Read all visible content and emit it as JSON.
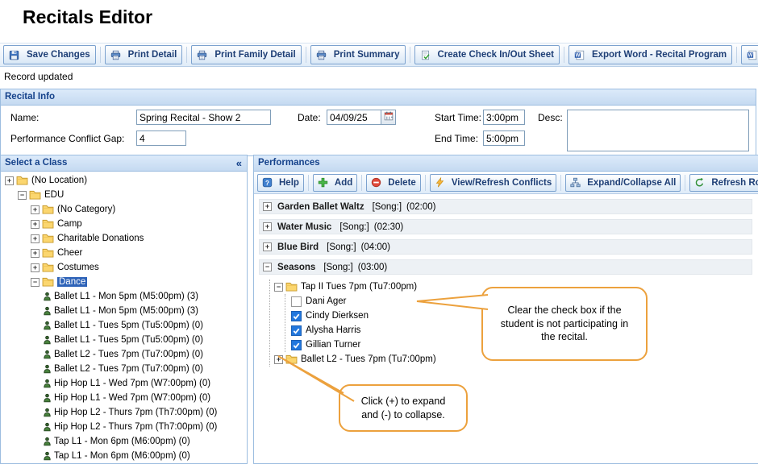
{
  "page_title": "Recitals Editor",
  "status_text": "Record updated",
  "toolbar": {
    "buttons": [
      {
        "label": "Save Changes",
        "icon": "save-icon",
        "name": "save-changes-button"
      },
      {
        "label": "Print Detail",
        "icon": "print-icon",
        "name": "print-detail-button"
      },
      {
        "label": "Print Family Detail",
        "icon": "print-icon",
        "name": "print-family-detail-button"
      },
      {
        "label": "Print Summary",
        "icon": "print-icon",
        "name": "print-summary-button"
      },
      {
        "label": "Create Check In/Out Sheet",
        "icon": "check-sheet-icon",
        "name": "create-check-in-out-sheet-button"
      },
      {
        "label": "Export Word - Recital Program",
        "icon": "word-icon",
        "name": "export-word-recital-program-button"
      },
      {
        "label": "",
        "icon": "word-icon",
        "name": "clipped-toolbar-button"
      }
    ]
  },
  "recital_info": {
    "header": "Recital Info",
    "name_label": "Name:",
    "name_value": "Spring Recital - Show 2",
    "gap_label": "Performance Conflict Gap:",
    "gap_value": "4",
    "date_label": "Date:",
    "date_value": "04/09/25",
    "start_label": "Start Time:",
    "start_value": "3:00pm",
    "end_label": "End Time:",
    "end_value": "5:00pm",
    "desc_label": "Desc:",
    "desc_value": ""
  },
  "class_panel": {
    "header": "Select a Class",
    "collapse_glyph": "«",
    "tree": [
      {
        "level": 0,
        "type": "folder",
        "expand": "+",
        "label": "(No Location)"
      },
      {
        "level": 1,
        "type": "folder",
        "expand": "-",
        "label": "EDU"
      },
      {
        "level": 2,
        "type": "folder",
        "expand": "+",
        "label": "(No Category)"
      },
      {
        "level": 2,
        "type": "folder",
        "expand": "+",
        "label": "Camp"
      },
      {
        "level": 2,
        "type": "folder",
        "expand": "+",
        "label": "Charitable Donations"
      },
      {
        "level": 2,
        "type": "folder",
        "expand": "+",
        "label": "Cheer"
      },
      {
        "level": 2,
        "type": "folder",
        "expand": "+",
        "label": "Costumes"
      },
      {
        "level": 2,
        "type": "folder",
        "expand": "-",
        "label": "Dance",
        "selected": true
      },
      {
        "level": 3,
        "type": "class",
        "label": "Ballet L1 - Mon 5pm (M5:00pm) (3)"
      },
      {
        "level": 3,
        "type": "class",
        "label": "Ballet L1 - Mon 5pm (M5:00pm) (3)"
      },
      {
        "level": 3,
        "type": "class",
        "label": "Ballet L1 - Tues 5pm (Tu5:00pm) (0)"
      },
      {
        "level": 3,
        "type": "class",
        "label": "Ballet L1 - Tues 5pm (Tu5:00pm) (0)"
      },
      {
        "level": 3,
        "type": "class",
        "label": "Ballet L2 - Tues 7pm (Tu7:00pm) (0)"
      },
      {
        "level": 3,
        "type": "class",
        "label": "Ballet L2 - Tues 7pm (Tu7:00pm) (0)"
      },
      {
        "level": 3,
        "type": "class",
        "label": "Hip Hop L1 - Wed 7pm (W7:00pm) (0)"
      },
      {
        "level": 3,
        "type": "class",
        "label": "Hip Hop L1 - Wed 7pm (W7:00pm) (0)"
      },
      {
        "level": 3,
        "type": "class",
        "label": "Hip Hop L2 - Thurs 7pm (Th7:00pm) (0)"
      },
      {
        "level": 3,
        "type": "class",
        "label": "Hip Hop L2 - Thurs 7pm (Th7:00pm) (0)"
      },
      {
        "level": 3,
        "type": "class",
        "label": "Tap L1 - Mon 6pm (M6:00pm) (0)"
      },
      {
        "level": 3,
        "type": "class",
        "label": "Tap L1 - Mon 6pm (M6:00pm) (0)"
      }
    ]
  },
  "performances_panel": {
    "header": "Performances",
    "toolbar": [
      {
        "label": "Help",
        "icon": "help-icon",
        "name": "help-button"
      },
      {
        "label": "Add",
        "icon": "add-icon",
        "name": "add-button"
      },
      {
        "label": "Delete",
        "icon": "delete-icon",
        "name": "delete-button"
      },
      {
        "label": "View/Refresh Conflicts",
        "icon": "conflicts-icon",
        "name": "view-refresh-conflicts-button"
      },
      {
        "label": "Expand/Collapse All",
        "icon": "expand-all-icon",
        "name": "expand-collapse-all-button"
      },
      {
        "label": "Refresh Rosters",
        "icon": "refresh-icon",
        "name": "refresh-rosters-button"
      }
    ],
    "rows": [
      {
        "expand": "+",
        "title": "Garden Ballet Waltz",
        "song": "[Song:]",
        "duration": "(02:00)"
      },
      {
        "expand": "+",
        "title": "Water Music",
        "song": "[Song:]",
        "duration": "(02:30)"
      },
      {
        "expand": "+",
        "title": "Blue Bird",
        "song": "[Song:]",
        "duration": "(04:00)"
      },
      {
        "expand": "-",
        "title": "Seasons",
        "song": "[Song:]",
        "duration": "(03:00)",
        "children": [
          {
            "expand": "-",
            "label": "Tap II Tues 7pm (Tu7:00pm)",
            "students": [
              {
                "name": "Dani Ager",
                "checked": false
              },
              {
                "name": "Cindy Dierksen",
                "checked": true
              },
              {
                "name": "Alysha Harris",
                "checked": true
              },
              {
                "name": "Gillian Turner",
                "checked": true
              }
            ]
          },
          {
            "expand": "+",
            "label": "Ballet L2 - Tues 7pm (Tu7:00pm)"
          }
        ]
      }
    ]
  },
  "callouts": [
    {
      "text": "Clear the check box if the student is not participating in the recital."
    },
    {
      "text": "Click (+) to expand and (-) to collapse."
    }
  ],
  "colors": {
    "header_text": "#15428b",
    "selection": "#2e63b8",
    "callout_border": "#eca13d",
    "checked_checkbox": "#2277dd"
  }
}
